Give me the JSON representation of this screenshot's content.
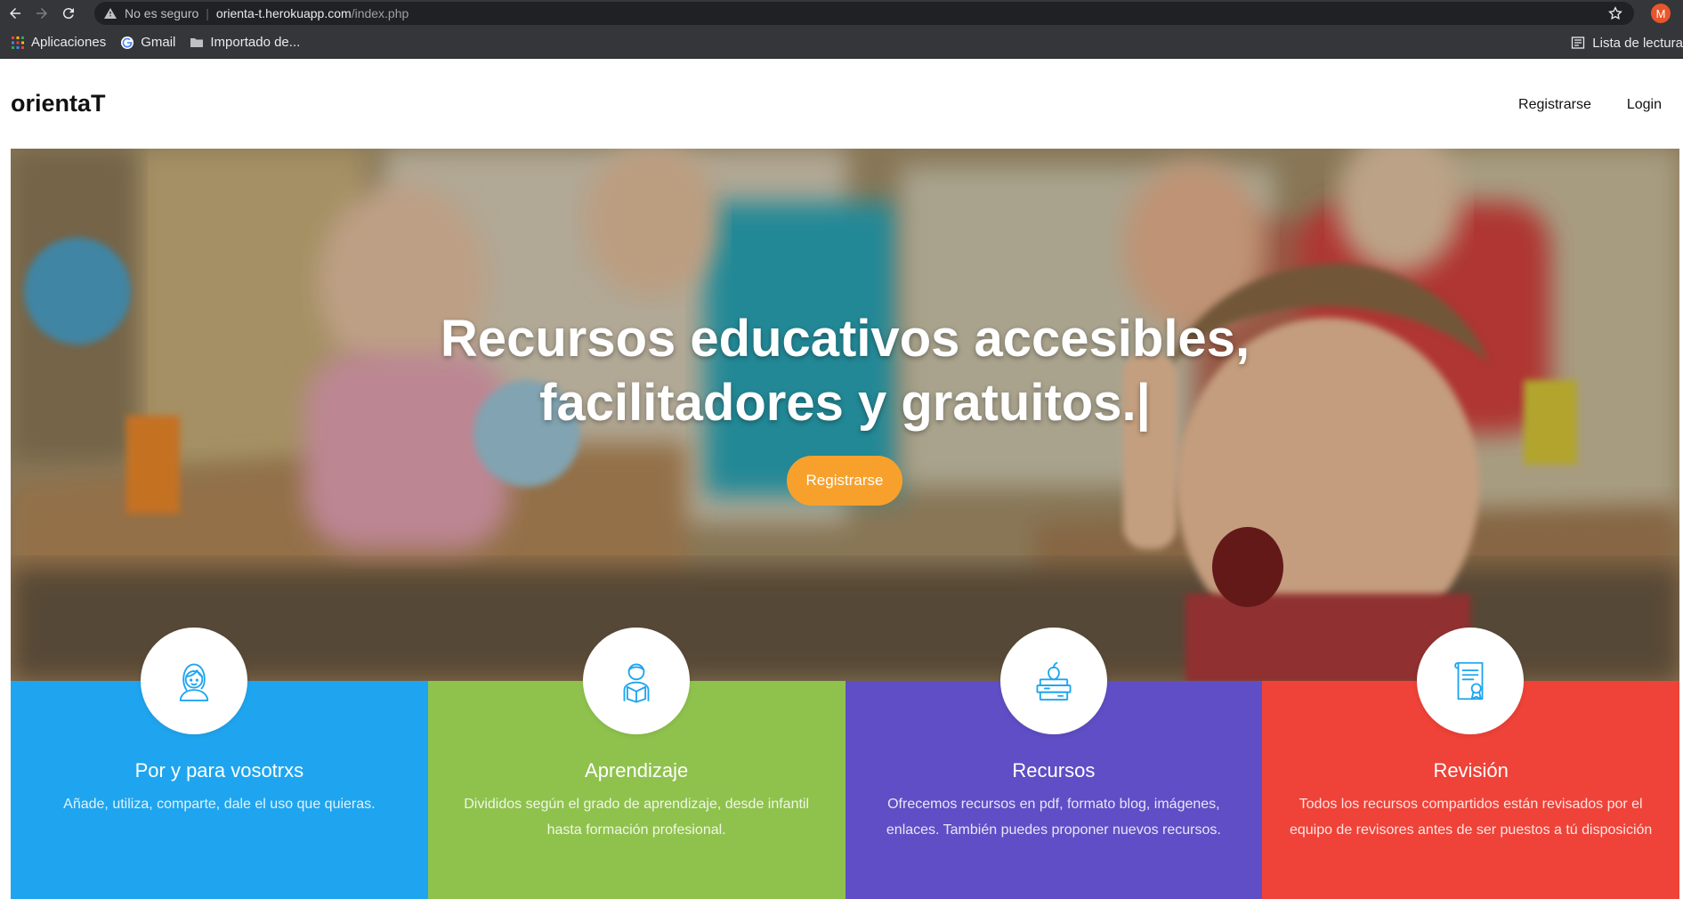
{
  "browser": {
    "insecure_label": "No es seguro",
    "url_host": "orienta-t.herokuapp.com",
    "url_path": "/index.php",
    "profile_initial": "M",
    "bookmarks": [
      {
        "label": "Aplicaciones",
        "icon": "apps-grid-icon"
      },
      {
        "label": "Gmail",
        "icon": "google-icon"
      },
      {
        "label": "Importado de...",
        "icon": "folder-icon"
      }
    ],
    "reading_list": "Lista de lectura"
  },
  "header": {
    "logo": "orientaT",
    "nav": [
      "Registrarse",
      "Login"
    ]
  },
  "hero": {
    "title_line1": "Recursos educativos accesibles,",
    "title_line2": "facilitadores y gratuitos.|",
    "cta": "Registrarse",
    "cta_color": "#f7a12c"
  },
  "features": [
    {
      "title": "Por y para vosotrxs",
      "text": "Añade, utiliza, comparte, dale el uso que quieras.",
      "color": "#1fa5ef",
      "icon": "girl-user-icon"
    },
    {
      "title": "Aprendizaje",
      "text": "Divididos según el grado de aprendizaje, desde infantil hasta formación profesional.",
      "color": "#8fc24d",
      "icon": "student-reading-icon"
    },
    {
      "title": "Recursos",
      "text": "Ofrecemos recursos en pdf, formato blog, imágenes, enlaces. También puedes proponer nuevos recursos.",
      "color": "#5f4ec5",
      "icon": "books-apple-icon"
    },
    {
      "title": "Revisión",
      "text": "Todos los recursos compartidos están revisados por el equipo de revisores antes de ser puestos a tú disposición",
      "color": "#ef4238",
      "icon": "certificate-icon"
    }
  ]
}
